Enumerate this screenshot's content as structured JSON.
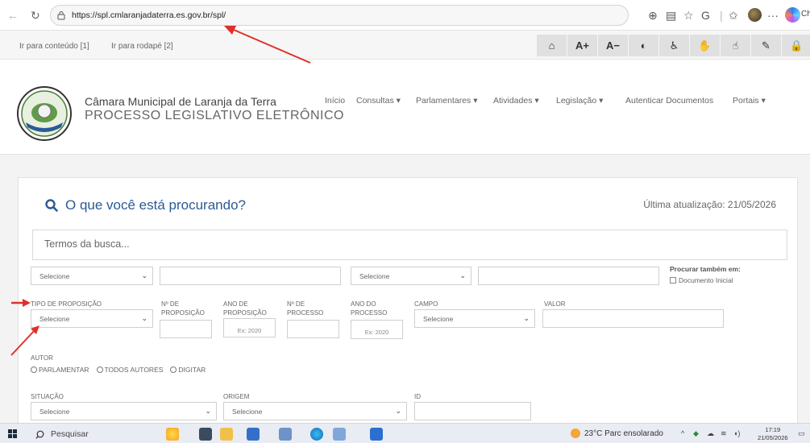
{
  "browser": {
    "url": "https://spl.cmlaranjadaterra.es.gov.br/spl/",
    "back_icon": "arrow-left-icon",
    "refresh_icon": "refresh-icon",
    "partial_tab_text": "Ch"
  },
  "accessibility": {
    "skip_content": "Ir para conteúdo [1]",
    "skip_footer": "Ir para rodapé [2]",
    "buttons": [
      {
        "icon": "home-icon",
        "glyph": "⌂"
      },
      {
        "label": "A+"
      },
      {
        "label": "A−"
      },
      {
        "icon": "contrast-icon",
        "glyph": "◐"
      },
      {
        "icon": "wheelchair-icon",
        "glyph": "♿"
      },
      {
        "icon": "sign-language-icon",
        "glyph": "✋"
      },
      {
        "icon": "hand-icon",
        "glyph": "☝"
      },
      {
        "icon": "edit-icon",
        "glyph": "✎"
      },
      {
        "icon": "lock-icon",
        "glyph": "🔒"
      }
    ]
  },
  "header": {
    "name": "Câmara Municipal de Laranja da Terra",
    "subtitle": "PROCESSO LEGISLATIVO ELETRÔNICO",
    "menu": [
      "Início",
      "Consultas ▾",
      "Parlamentares ▾",
      "Atividades ▾",
      "Legislação ▾",
      "Autenticar Documentos",
      "Portais ▾"
    ]
  },
  "search": {
    "title": "O que você está procurando?",
    "last_update": "Última atualização: 21/05/2026",
    "terms_placeholder": "Termos da busca...",
    "select_placeholder": "Selecione",
    "also_search_title": "Procurar também em:",
    "also_search_option": "Documento Inicial",
    "labels": {
      "tipo": "TIPO DE PROPOSIÇÃO",
      "num_prop": "Nº DE PROPOSIÇÃO",
      "ano_prop": "ANO DE PROPOSIÇÃO",
      "num_proc": "Nº DE PROCESSO",
      "ano_proc": "ANO DO PROCESSO",
      "campo": "CAMPO",
      "valor": "VALOR",
      "autor": "AUTOR",
      "situacao": "SITUAÇÃO",
      "origem": "ORIGEM",
      "id": "ID"
    },
    "year_placeholder": "Ex: 2020",
    "autor_options": [
      "PARLAMENTAR",
      "TODOS AUTORES",
      "DIGITAR"
    ]
  },
  "taskbar": {
    "search_placeholder": "Pesquisar",
    "weather": "23°C  Parc ensolarado",
    "time": "17:19",
    "date": "21/05/2026"
  },
  "colors": {
    "accent": "#2a5b97",
    "annotation": "#e0302a"
  }
}
